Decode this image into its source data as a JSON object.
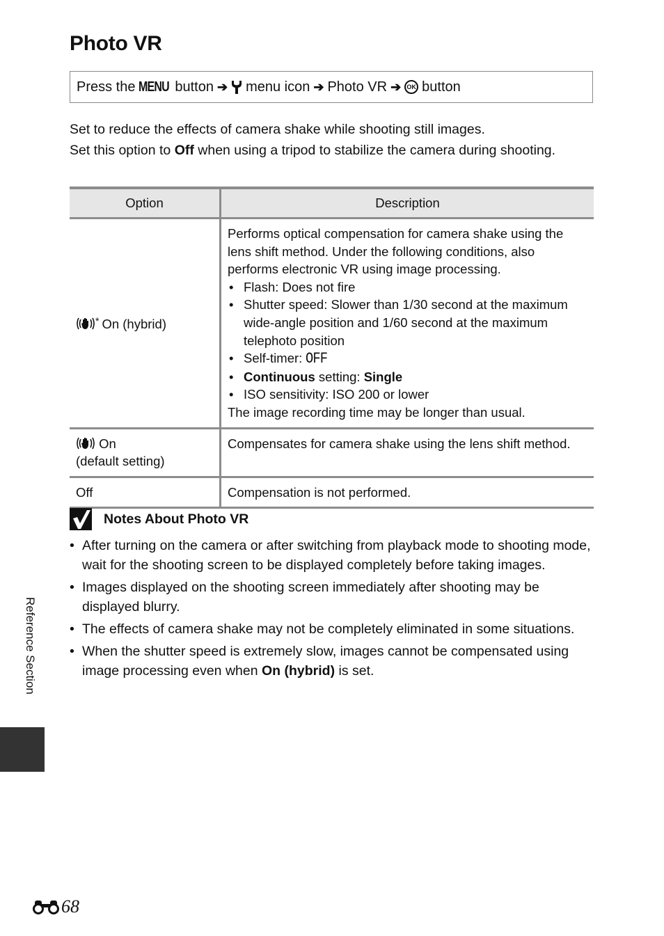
{
  "page": {
    "title": "Photo VR",
    "side_tab_label": "Reference Section",
    "page_number": "68",
    "page_prefix_icon": "binoculars-icon"
  },
  "nav_path": {
    "press_the": "Press the",
    "menu_glyph": "MENU",
    "button_word_1": "button",
    "arrow": "➔",
    "menu_icon": "menu icon",
    "photo_vr": "Photo VR",
    "ok_glyph": "OK",
    "button_word_2": "button",
    "icons": [
      "menu-button-icon",
      "wrench-setup-icon",
      "ok-button-icon"
    ]
  },
  "intro": {
    "line1": "Set to reduce the effects of camera shake while shooting still images.",
    "line2_pre": "Set this option to ",
    "line2_bold": "Off",
    "line2_post": " when using a tripod to stabilize the camera during shooting."
  },
  "table": {
    "headers": [
      "Option",
      "Description"
    ],
    "rows": [
      {
        "option_label": "On (hybrid)",
        "option_icon": "vr-hybrid-icon",
        "option_marker": "*",
        "desc_intro": "Performs optical compensation for camera shake using the lens shift method. Under the following conditions, also performs electronic VR using image processing.",
        "bullets": [
          {
            "text": "Flash: Does not fire"
          },
          {
            "text": "Shutter speed: Slower than 1/30 second at the maximum wide-angle position and 1/60 second at the maximum telephoto position"
          },
          {
            "pre": "Self-timer: ",
            "glyph": "OFF"
          },
          {
            "bold1": "Continuous",
            "mid": " setting: ",
            "bold2": "Single"
          },
          {
            "text": "ISO sensitivity: ISO 200 or lower"
          }
        ],
        "desc_outro": "The image recording time may be longer than usual."
      },
      {
        "option_label": "On",
        "option_icon": "vr-on-icon",
        "option_sub": "(default setting)",
        "desc": "Compensates for camera shake using the lens shift method."
      },
      {
        "option_label": "Off",
        "desc": "Compensation is not performed."
      }
    ]
  },
  "notes": {
    "heading": "Notes About Photo VR",
    "items": [
      {
        "text": "After turning on the camera or after switching from playback mode to shooting mode, wait for the shooting screen to be displayed completely before taking images."
      },
      {
        "text": "Images displayed on the shooting screen immediately after shooting may be displayed blurry."
      },
      {
        "text": "The effects of camera shake may not be completely eliminated in some situations."
      },
      {
        "pre": "When the shutter speed is extremely slow, images cannot be compensated using image processing even when ",
        "bold": "On (hybrid)",
        "post": " is set."
      }
    ]
  }
}
